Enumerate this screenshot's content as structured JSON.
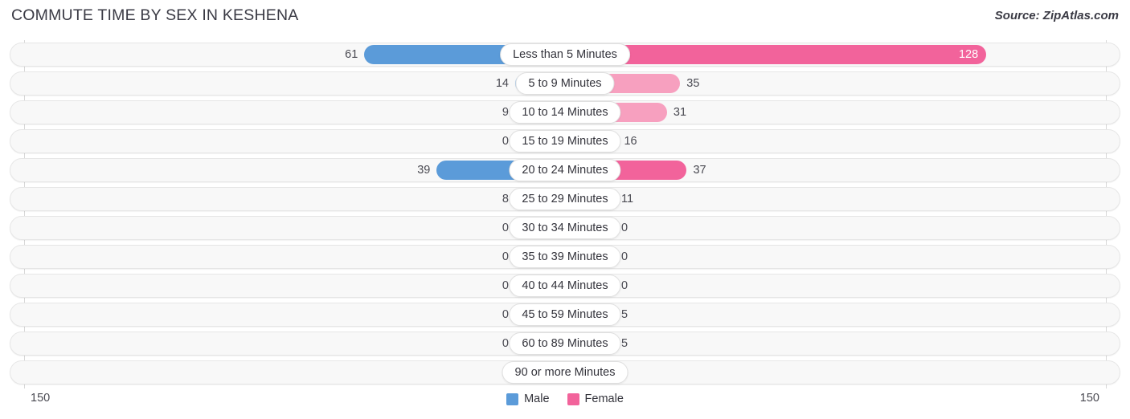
{
  "header": {
    "title": "COMMUTE TIME BY SEX IN KESHENA",
    "source": "Source: ZipAtlas.com"
  },
  "axis": {
    "left_tick": "150",
    "right_tick": "150"
  },
  "legend": {
    "items": [
      {
        "label": "Male",
        "color": "#5b9bd9"
      },
      {
        "label": "Female",
        "color": "#f2639b"
      }
    ]
  },
  "chart_data": {
    "type": "bar",
    "orientation": "horizontal-diverging",
    "title": "COMMUTE TIME BY SEX IN KESHENA",
    "subtitle": "Source: ZipAtlas.com",
    "xlabel": "",
    "ylabel": "",
    "xlim": [
      -150,
      150
    ],
    "axis_max": 150,
    "grid": false,
    "legend_position": "bottom-center",
    "categories": [
      "Less than 5 Minutes",
      "5 to 9 Minutes",
      "10 to 14 Minutes",
      "15 to 19 Minutes",
      "20 to 24 Minutes",
      "25 to 29 Minutes",
      "30 to 34 Minutes",
      "35 to 39 Minutes",
      "40 to 44 Minutes",
      "45 to 59 Minutes",
      "60 to 89 Minutes",
      "90 or more Minutes"
    ],
    "series": [
      {
        "name": "Male",
        "color": "#5b9bd9",
        "values": [
          61,
          14,
          9,
          0,
          39,
          8,
          0,
          0,
          0,
          0,
          0,
          0
        ]
      },
      {
        "name": "Female",
        "color": "#f2639b",
        "values": [
          128,
          35,
          31,
          16,
          37,
          11,
          0,
          0,
          0,
          5,
          5,
          0
        ]
      }
    ]
  },
  "rows": [
    {
      "label": "Less than 5 Minutes",
      "male": "61",
      "female": "128",
      "male_v": 61,
      "female_v": 128,
      "highlight": true,
      "female_inside": true
    },
    {
      "label": "5 to 9 Minutes",
      "male": "14",
      "female": "35",
      "male_v": 14,
      "female_v": 35,
      "highlight": false,
      "female_inside": false
    },
    {
      "label": "10 to 14 Minutes",
      "male": "9",
      "female": "31",
      "male_v": 9,
      "female_v": 31,
      "highlight": false,
      "female_inside": false
    },
    {
      "label": "15 to 19 Minutes",
      "male": "0",
      "female": "16",
      "male_v": 0,
      "female_v": 16,
      "highlight": false,
      "female_inside": false
    },
    {
      "label": "20 to 24 Minutes",
      "male": "39",
      "female": "37",
      "male_v": 39,
      "female_v": 37,
      "highlight": true,
      "female_inside": false
    },
    {
      "label": "25 to 29 Minutes",
      "male": "8",
      "female": "11",
      "male_v": 8,
      "female_v": 11,
      "highlight": false,
      "female_inside": false
    },
    {
      "label": "30 to 34 Minutes",
      "male": "0",
      "female": "0",
      "male_v": 0,
      "female_v": 0,
      "highlight": false,
      "female_inside": false
    },
    {
      "label": "35 to 39 Minutes",
      "male": "0",
      "female": "0",
      "male_v": 0,
      "female_v": 0,
      "highlight": false,
      "female_inside": false
    },
    {
      "label": "40 to 44 Minutes",
      "male": "0",
      "female": "0",
      "male_v": 0,
      "female_v": 0,
      "highlight": false,
      "female_inside": false
    },
    {
      "label": "45 to 59 Minutes",
      "male": "0",
      "female": "5",
      "male_v": 0,
      "female_v": 5,
      "highlight": false,
      "female_inside": false
    },
    {
      "label": "60 to 89 Minutes",
      "male": "0",
      "female": "5",
      "male_v": 0,
      "female_v": 5,
      "highlight": false,
      "female_inside": false
    },
    {
      "label": "90 or more Minutes",
      "male": "0",
      "female": "0",
      "male_v": 0,
      "female_v": 0,
      "highlight": false,
      "female_inside": false
    }
  ]
}
